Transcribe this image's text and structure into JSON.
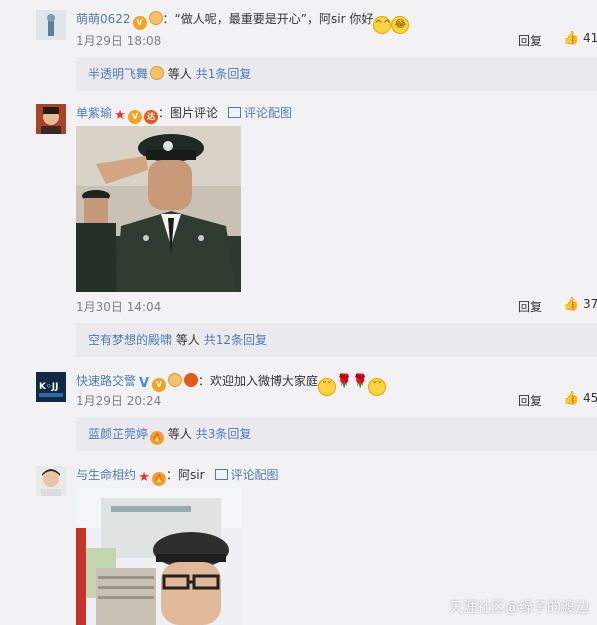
{
  "comments": [
    {
      "user": "萌萌0622",
      "text": "：“做人呢，最重要是开心”，阿sir 你好",
      "time": "1月29日 18:08",
      "reply_label": "回复",
      "likes": "41",
      "subreply": {
        "user": "半透明飞舞",
        "suffix": "等人",
        "count_text": "共1条回复"
      }
    },
    {
      "user": "单紫瑜",
      "text": "：图片评论",
      "pic_link": "评论配图",
      "time": "1月30日 14:04",
      "reply_label": "回复",
      "likes": "37",
      "subreply": {
        "user": "空有梦想的殿啸",
        "suffix": "等人",
        "count_text": "共12条回复"
      }
    },
    {
      "user": "快速路交警",
      "text": "：欢迎加入微博大家庭",
      "time": "1月29日 20:24",
      "reply_label": "回复",
      "likes": "45",
      "subreply": {
        "user": "蓝颜芷莞婷",
        "suffix": "等人",
        "count_text": "共3条回复"
      }
    },
    {
      "user": "与生命相约",
      "text": "：阿sir",
      "pic_link": "评论配图"
    }
  ],
  "watermark": "天涯社区@绿子的渡边",
  "colors": {
    "link": "#507daf",
    "name": "#eb7350",
    "background": "#f2f2f5"
  }
}
